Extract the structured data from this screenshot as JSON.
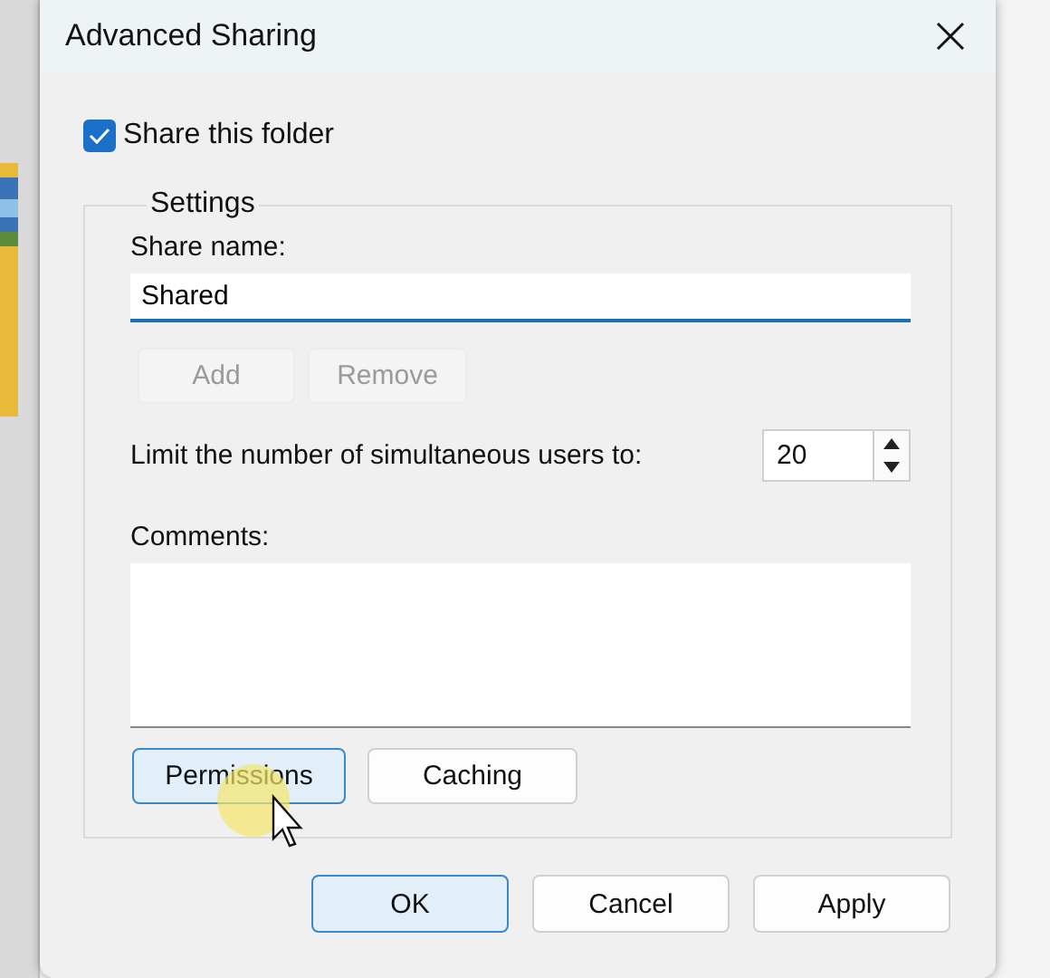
{
  "window": {
    "title": "Advanced Sharing"
  },
  "share_folder": {
    "label": "Share this folder",
    "checked": true
  },
  "settings": {
    "title": "Settings",
    "share_name": {
      "label": "Share name:",
      "value": "Shared"
    },
    "name_buttons": [
      {
        "label": "Add",
        "disabled": true
      },
      {
        "label": "Remove",
        "disabled": true
      }
    ],
    "user_limit": {
      "label": "Limit the number of simultaneous users to:",
      "value": "20"
    },
    "comments": {
      "label": "Comments:"
    },
    "buttons": [
      {
        "label": "Permissions",
        "focused": true
      },
      {
        "label": "Caching",
        "focused": false
      }
    ]
  },
  "buttons": [
    {
      "label": "OK",
      "default": true
    },
    {
      "label": "Cancel",
      "default": false
    },
    {
      "label": "Apply",
      "default": false
    }
  ]
}
